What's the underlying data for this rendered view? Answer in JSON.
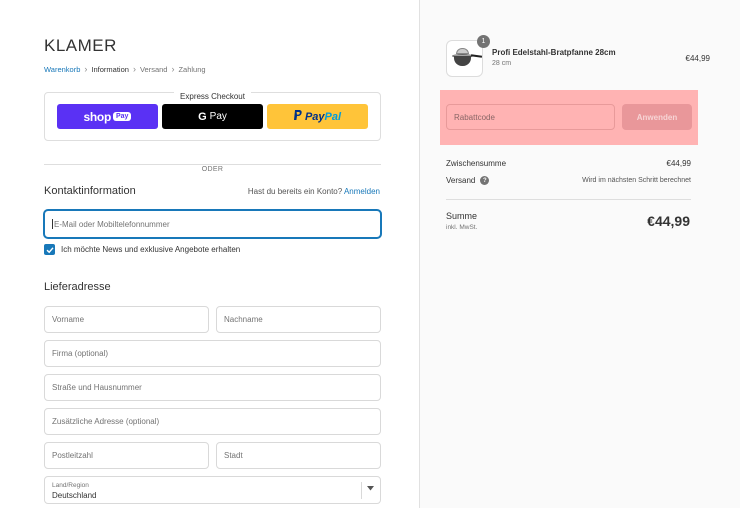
{
  "brand": {
    "logo": "KLAMER"
  },
  "breadcrumb": {
    "items": [
      {
        "label": "Warenkorb"
      },
      {
        "label": "Information"
      },
      {
        "label": "Versand"
      },
      {
        "label": "Zahlung"
      }
    ],
    "separator": "›"
  },
  "express_checkout": {
    "title": "Express Checkout",
    "shop_pay": {
      "word": "shop",
      "pill": "Pay"
    },
    "google_pay": {
      "mark": "G",
      "word": "Pay"
    },
    "paypal": {
      "word_dark": "Pay",
      "word_light": "Pal"
    }
  },
  "or_divider": "ODER",
  "contact": {
    "title": "Kontaktinformation",
    "login_prompt": "Hast du bereits ein Konto?",
    "login_link": "Anmelden",
    "email_placeholder": "E-Mail oder Mobiltelefonnummer",
    "newsletter_label": "Ich möchte News und exklusive Angebote erhalten",
    "newsletter_checked": true
  },
  "shipping": {
    "title": "Lieferadresse",
    "first_name_placeholder": "Vorname",
    "last_name_placeholder": "Nachname",
    "company_placeholder": "Firma (optional)",
    "street_placeholder": "Straße und Hausnummer",
    "address2_placeholder": "Zusätzliche Adresse (optional)",
    "zip_placeholder": "Postleitzahl",
    "city_placeholder": "Stadt",
    "country_label": "Land/Region",
    "country_value": "Deutschland"
  },
  "summary": {
    "product": {
      "name": "Profi Edelstahl-Bratpfanne 28cm",
      "variant": "28 cm",
      "price": "€44,99",
      "quantity": "1"
    },
    "discount": {
      "placeholder": "Rabattcode",
      "button": "Anwenden"
    },
    "subtotal_label": "Zwischensumme",
    "subtotal_value": "€44,99",
    "shipping_label": "Versand",
    "shipping_note": "Wird im nächsten Schritt berechnet",
    "total_label": "Summe",
    "total_sub": "inkl. MwSt.",
    "total_value": "€44,99"
  },
  "colors": {
    "accent": "#1878b9",
    "shop_pay": "#5a31f4",
    "paypal": "#ffc439",
    "highlight": "#ffb3b3"
  }
}
